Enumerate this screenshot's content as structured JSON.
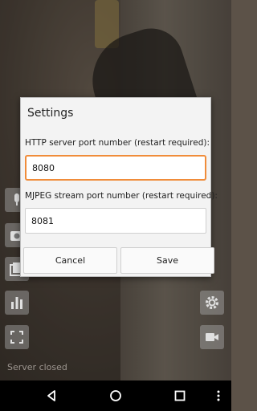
{
  "dialog": {
    "title": "Settings",
    "http_port_label": "HTTP server port number (restart required):",
    "http_port_value": "8080",
    "mjpeg_port_label": "MJPEG stream port number (restart required):",
    "mjpeg_port_value": "8081",
    "cancel_label": "Cancel",
    "save_label": "Save"
  },
  "status": {
    "text": "Server closed"
  },
  "icons": {
    "left": [
      "microphone-icon",
      "photo-icon",
      "gallery-icon",
      "stats-icon",
      "fullscreen-icon"
    ],
    "right": [
      "settings-icon",
      "video-icon"
    ],
    "nav": [
      "back-icon",
      "home-icon",
      "recents-icon",
      "more-icon"
    ]
  },
  "colors": {
    "focus_border": "#f08c3a",
    "dialog_bg": "#f3f3f3",
    "nav_bg": "#000000"
  }
}
